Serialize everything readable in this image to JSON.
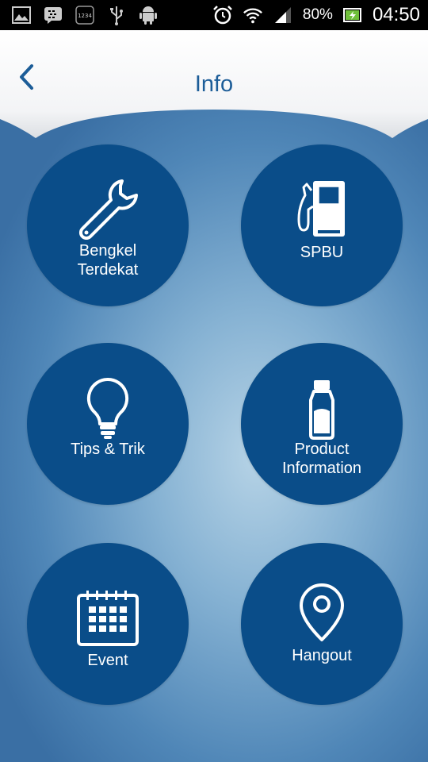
{
  "status_bar": {
    "battery": "80%",
    "time": "04:50",
    "left_icons": [
      "gallery-icon",
      "bbm-icon",
      "keyboard-1234-icon",
      "usb-icon",
      "android-icon"
    ],
    "right_icons": [
      "alarm-icon",
      "wifi-icon",
      "signal-icon",
      "battery-charging-icon"
    ]
  },
  "header": {
    "title": "Info",
    "back_icon": "chevron-left-icon"
  },
  "menu": [
    {
      "label_line1": "Bengkel",
      "label_line2": "Terdekat",
      "icon": "wrench-icon"
    },
    {
      "label_line1": "SPBU",
      "label_line2": "",
      "icon": "fuel-pump-icon"
    },
    {
      "label_line1": "Tips & Trik",
      "label_line2": "",
      "icon": "lightbulb-icon"
    },
    {
      "label_line1": "Product",
      "label_line2": "Information",
      "icon": "oil-bottle-icon"
    },
    {
      "label_line1": "Event",
      "label_line2": "",
      "icon": "calendar-icon"
    },
    {
      "label_line1": "Hangout",
      "label_line2": "",
      "icon": "map-pin-icon"
    }
  ],
  "colors": {
    "tile": "#0a4d89",
    "accent": "#1c5d98",
    "status_bar": "#000000"
  }
}
